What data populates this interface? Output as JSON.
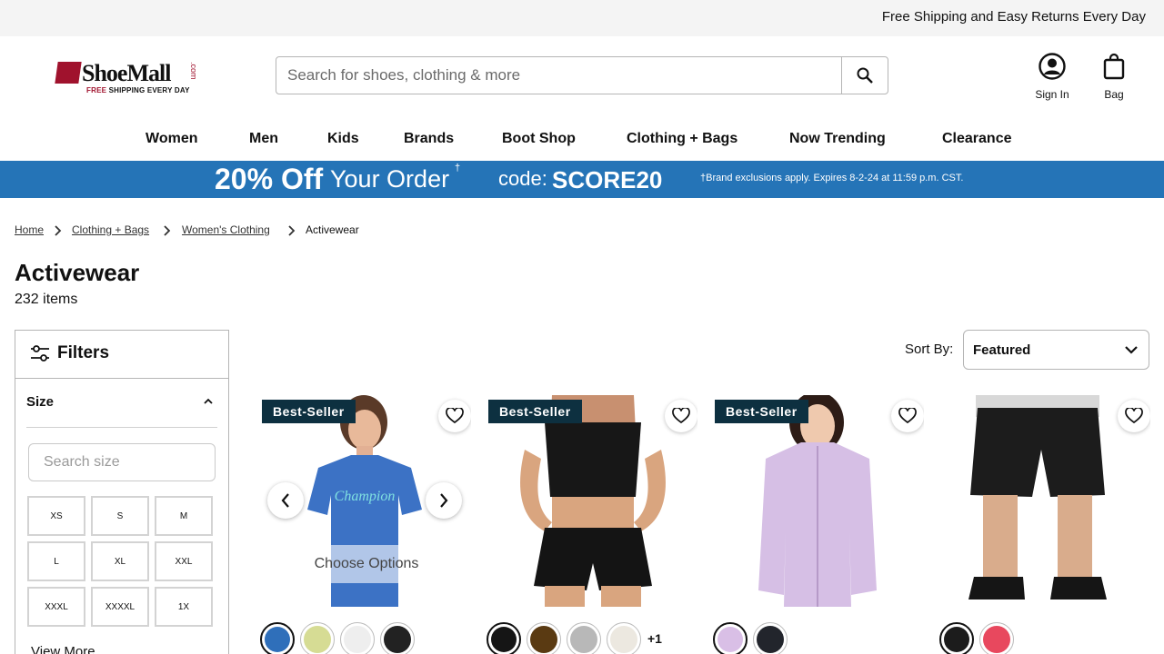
{
  "topbar": {
    "text": "Free Shipping and Easy Returns Every Day"
  },
  "logo": {
    "name": "ShoeMall",
    "com": ".com",
    "tagline_free": "FREE",
    "tagline_rest": " SHIPPING EVERY DAY"
  },
  "search": {
    "placeholder": "Search for shoes, clothing & more",
    "icon": "search-icon"
  },
  "header_actions": {
    "signin_label": "Sign In",
    "bag_label": "Bag"
  },
  "nav": [
    "Women",
    "Men",
    "Kids",
    "Brands",
    "Boot Shop",
    "Clothing + Bags",
    "Now Trending",
    "Clearance"
  ],
  "promo": {
    "percent": "20% Off",
    "rest": "Your Order",
    "dagger": "†",
    "code_label": "code:",
    "code": "SCORE20",
    "disclaimer": "†Brand exclusions apply. Expires 8-2-24 at 11:59 p.m. CST.",
    "background": "#2574b7"
  },
  "breadcrumbs": [
    "Home",
    "Clothing + Bags",
    "Women's Clothing",
    "Activewear"
  ],
  "page": {
    "title": "Activewear",
    "count": "232 items"
  },
  "filters": {
    "title": "Filters",
    "size_heading": "Size",
    "size_search_placeholder": "Search size",
    "sizes": [
      "XS",
      "S",
      "M",
      "L",
      "XL",
      "XXL",
      "XXXL",
      "XXXXL",
      "1X"
    ],
    "view_more": "View More"
  },
  "sort": {
    "label": "Sort By:",
    "value": "Featured"
  },
  "products": [
    {
      "badge": "Best-Seller",
      "hover_label": "Choose Options",
      "swatches": [
        "#2f6fba",
        "#d6dc94",
        "#eeeeee",
        "#222222"
      ],
      "more": ""
    },
    {
      "badge": "Best-Seller",
      "hover_label": "",
      "swatches": [
        "#151515",
        "#5a3a12",
        "#b8b8b8",
        "#ece8e0"
      ],
      "more": "+1"
    },
    {
      "badge": "Best-Seller",
      "hover_label": "",
      "swatches": [
        "#d9bfe6",
        "#22252c"
      ],
      "more": ""
    },
    {
      "badge": "",
      "hover_label": "",
      "swatches": [
        "#1c1c1c",
        "#e8485e"
      ],
      "more": ""
    }
  ]
}
